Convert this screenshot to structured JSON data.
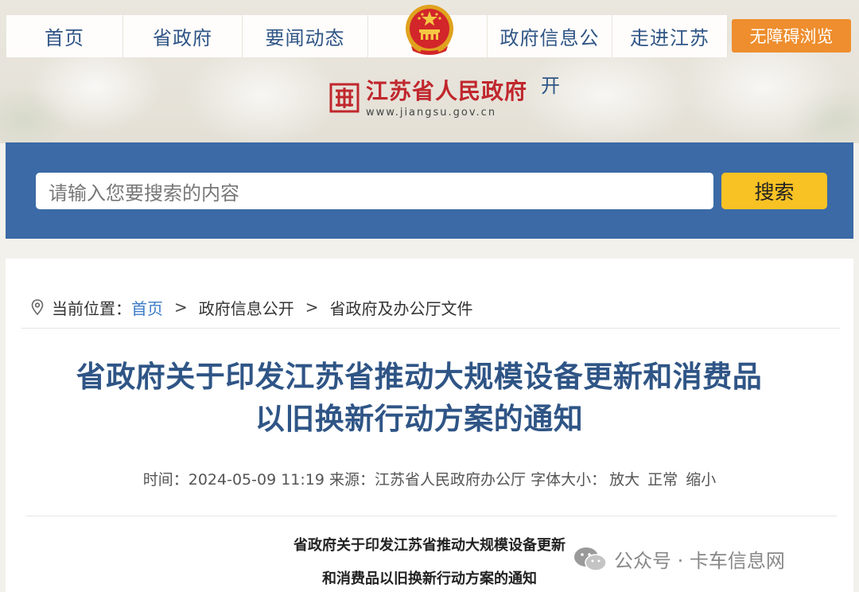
{
  "nav": {
    "items": [
      "首页",
      "省政府",
      "要闻动态",
      "政府信息公",
      "走进江苏"
    ],
    "accessibility": "无障碍浏览"
  },
  "logo": {
    "name": "江苏省人民政府",
    "url": "www.jiangsu.gov.cn",
    "overflow_text": "开"
  },
  "search": {
    "placeholder": "请输入您要搜索的内容",
    "button": "搜索"
  },
  "breadcrumb": {
    "label": "当前位置：",
    "home": "首页",
    "sep": ">",
    "level2": "政府信息公开",
    "level3": "省政府及办公厅文件"
  },
  "article": {
    "title_line1": "省政府关于印发江苏省推动大规模设备更新和消费品",
    "title_line2": "以旧换新行动方案的通知",
    "meta_time_label": "时间：",
    "meta_time": "2024-05-09 11:19",
    "meta_source_label": "来源：",
    "meta_source": "江苏省人民政府办公厅",
    "meta_fontsize_label": "字体大小：",
    "fs_large": "放大",
    "fs_normal": "正常",
    "fs_small": "缩小",
    "doc_title_line1": "省政府关于印发江苏省推动大规模设备更新",
    "doc_title_line2": "和消费品以旧换新行动方案的通知"
  },
  "watermark": {
    "text": "公众号 · 卡车信息网"
  },
  "colors": {
    "nav_text": "#2f5586",
    "accent_orange": "#ee8e2e",
    "search_band": "#3b6aa6",
    "search_button": "#f8c224",
    "logo_red": "#c0272d",
    "link_blue": "#3a7bc8"
  }
}
